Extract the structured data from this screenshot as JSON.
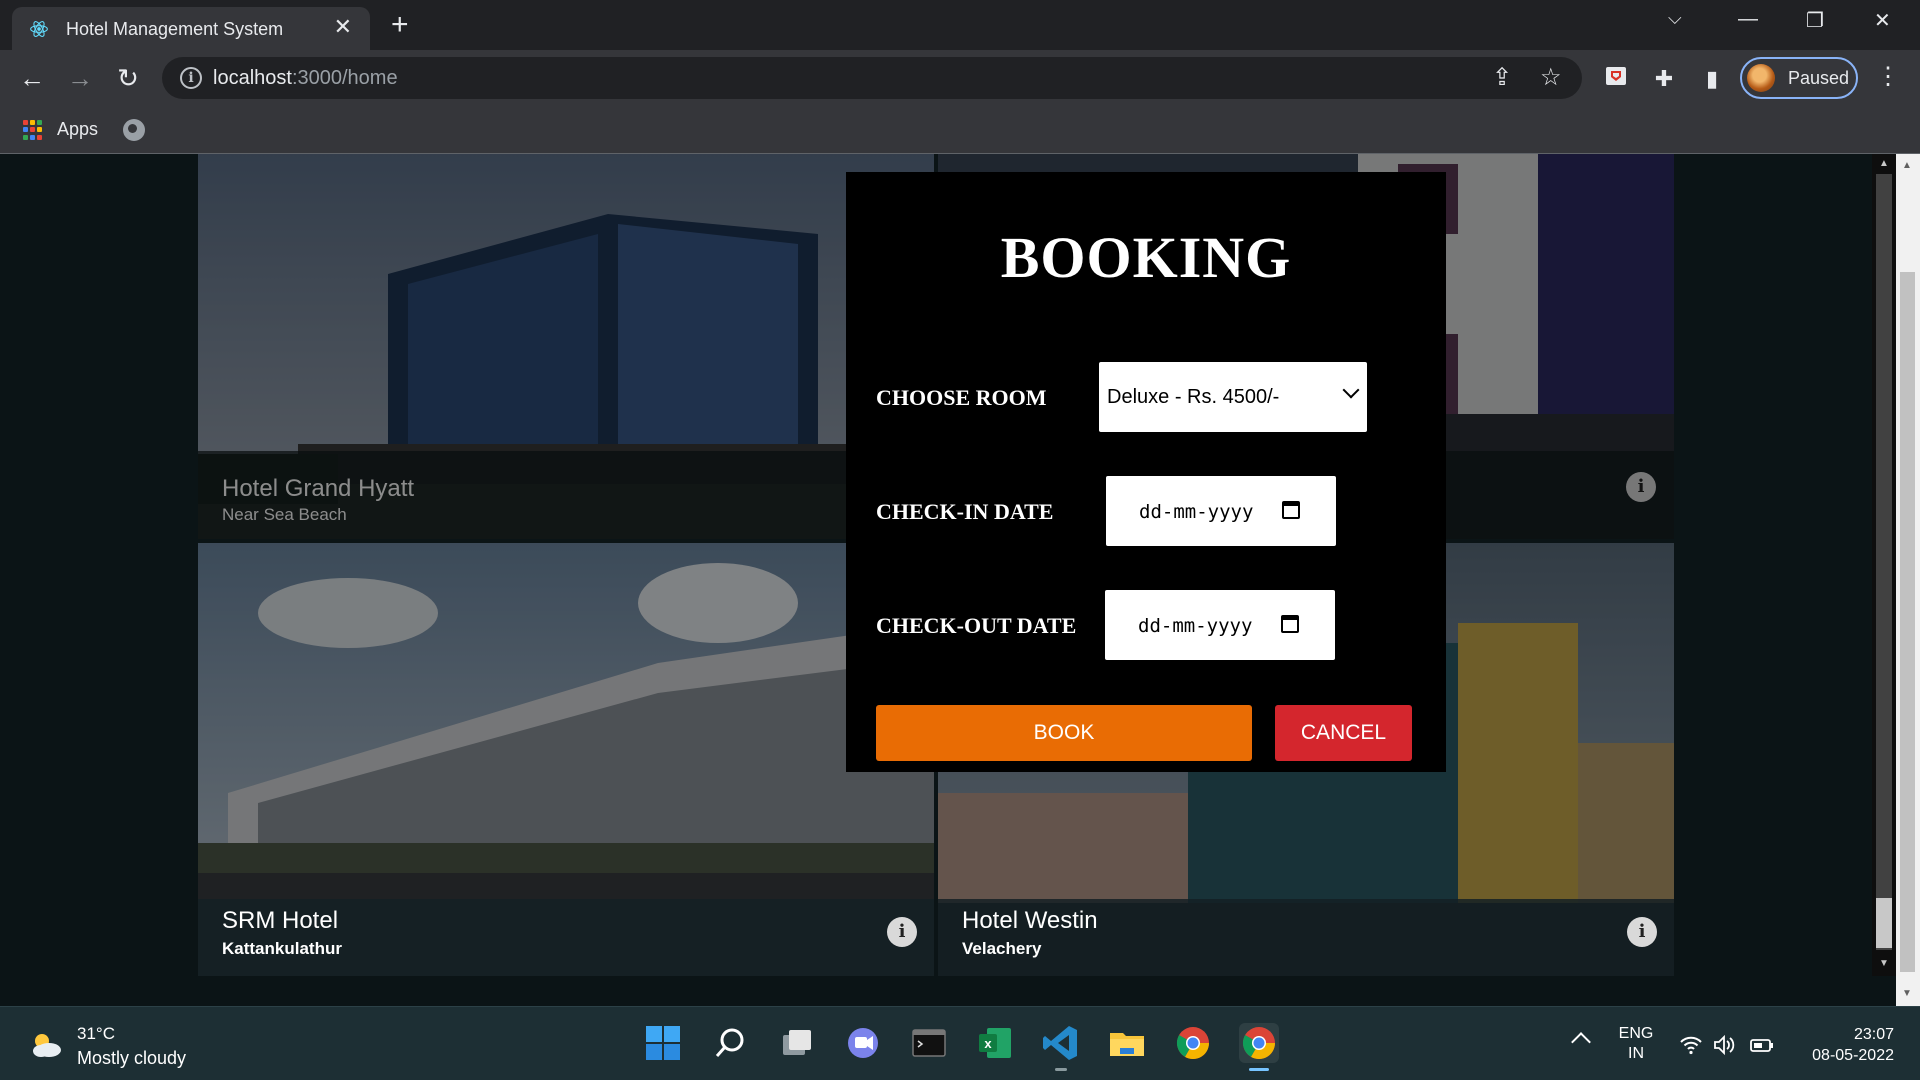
{
  "browser": {
    "tab_title": "Hotel Management System",
    "tab_close": "✕",
    "new_tab": "+",
    "url_host": "localhost",
    "url_path": ":3000/home",
    "profile_label": "Paused",
    "bookmark_apps": "Apps",
    "window_controls": {
      "menu": "⌵",
      "minimize": "—",
      "restore": "❐",
      "close": "✕"
    }
  },
  "hotels": [
    {
      "name": "Hotel Grand Hyatt",
      "location": "Near Sea Beach"
    },
    {
      "name": "",
      "location": ""
    },
    {
      "name": "SRM Hotel",
      "location": "Kattankulathur"
    },
    {
      "name": "Hotel Westin",
      "location": "Velachery"
    }
  ],
  "modal": {
    "title": "BOOKING",
    "choose_room_label": "CHOOSE ROOM",
    "room_selected": "Deluxe - Rs. 4500/-",
    "checkin_label": "CHECK-IN DATE",
    "checkin_value": "dd-mm-yyyy",
    "checkout_label": "CHECK-OUT DATE",
    "checkout_value": "dd-mm-yyyy",
    "book_label": "BOOK",
    "cancel_label": "CANCEL",
    "colors": {
      "book": "#e96c04",
      "cancel": "#d4262d"
    }
  },
  "taskbar": {
    "weather_temp": "31°C",
    "weather_condition": "Mostly cloudy",
    "lang_top": "ENG",
    "lang_bottom": "IN",
    "time": "23:07",
    "date": "08-05-2022"
  }
}
